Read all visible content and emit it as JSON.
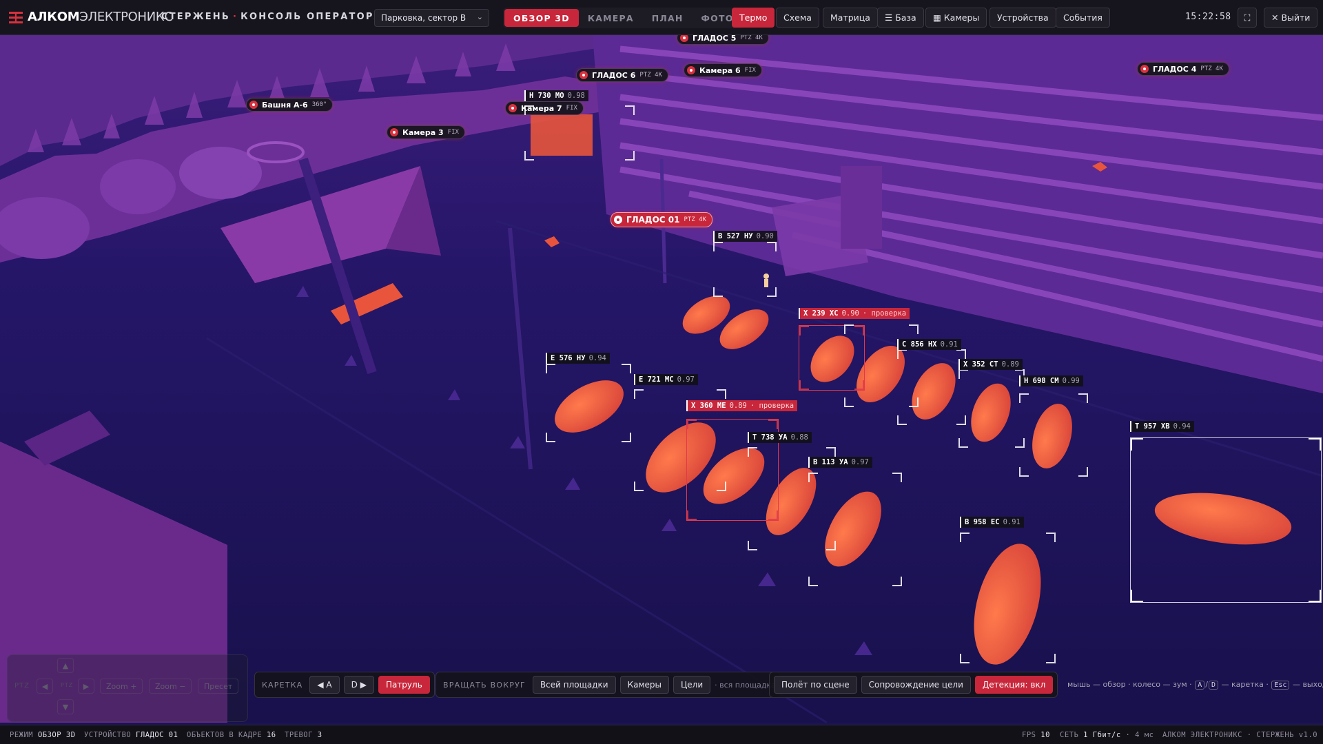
{
  "header": {
    "brand_bold": "АЛКОМ",
    "brand_thin": "ЭЛЕКТРОНИКС",
    "app_name": "СТЕРЖЕНЬ",
    "app_sep": "·",
    "app_section": "КОНСОЛЬ ОПЕРАТОРА",
    "sector": "Парковка, сектор В",
    "view_tabs": [
      {
        "label": "ОБЗОР 3D",
        "active": true
      },
      {
        "label": "КАМЕРА",
        "active": false
      },
      {
        "label": "ПЛАН",
        "active": false
      },
      {
        "label": "ФОТО",
        "active": false
      }
    ],
    "thermo": "Термо",
    "scheme": "Схема",
    "matrix": "Матрица",
    "base": "☰ База",
    "cameras": "▦ Камеры",
    "devices": "Устройства",
    "events": "События",
    "clock": "15:22:58",
    "fullscreen_icon": "⛶",
    "logout": "✕ Выйти"
  },
  "cameras": [
    {
      "name": "ГЛАДОС 5",
      "type": "PTZ 4K"
    },
    {
      "name": "Камера 6",
      "type": "FIX"
    },
    {
      "name": "ГЛАДОС 6",
      "type": "PTZ 4K"
    },
    {
      "name": "ГЛАДОС 4",
      "type": "PTZ 4K"
    },
    {
      "name": "Башня А-6",
      "type": "360°"
    },
    {
      "name": "Камера 7",
      "type": "FIX"
    },
    {
      "name": "Камера 3",
      "type": "FIX"
    },
    {
      "name": "ГЛАДОС 01",
      "type": "PTZ 4K"
    }
  ],
  "plates": [
    {
      "text": "Н 730 МО",
      "conf": "0.98",
      "note": ""
    },
    {
      "text": "В 527 НУ",
      "conf": "0.90",
      "note": ""
    },
    {
      "text": "Х 239 ХС",
      "conf": "0.90",
      "note": "· проверка"
    },
    {
      "text": "С 856 НХ",
      "conf": "0.91",
      "note": ""
    },
    {
      "text": "Х 352 СТ",
      "conf": "0.89",
      "note": ""
    },
    {
      "text": "Е 576 НУ",
      "conf": "0.94",
      "note": ""
    },
    {
      "text": "Н 698 СМ",
      "conf": "0.99",
      "note": ""
    },
    {
      "text": "Е 721 МС",
      "conf": "0.97",
      "note": ""
    },
    {
      "text": "Х 360 МЕ",
      "conf": "0.89",
      "note": "· проверка"
    },
    {
      "text": "Т 738 УА",
      "conf": "0.88",
      "note": ""
    },
    {
      "text": "В 113 УА",
      "conf": "0.97",
      "note": ""
    },
    {
      "text": "Т 957 ХВ",
      "conf": "0.94",
      "note": ""
    },
    {
      "text": "В 958 ЕС",
      "conf": "0.91",
      "note": ""
    }
  ],
  "ptz": {
    "label": "PTZ",
    "up": "▲",
    "down": "▼",
    "left": "◀",
    "right": "▶",
    "zoom_in": "Zoom +",
    "zoom_out": "Zoom −",
    "preset": "Пресет"
  },
  "controls": {
    "carriage_label": "КАРЕТКА",
    "carriage_left": "◀ A",
    "carriage_right": "D ▶",
    "patrol": "Патруль",
    "orbit_label": "ВРАЩАТЬ ВОКРУГ",
    "orbit_site": "Всей площадки",
    "orbit_cameras": "Камеры",
    "orbit_targets": "Цели",
    "orbit_note": "· вся площадка",
    "fly": "Полёт по сцене",
    "follow": "Сопровождение цели",
    "detection": "Детекция: вкл"
  },
  "hint": {
    "mouse": "мышь — обзор · колесо — зум ·",
    "key_a": "A",
    "slash": "/",
    "key_d": "D",
    "carriage": "— каретка ·",
    "key_esc": "Esc",
    "exit": "— выход"
  },
  "status": {
    "mode_label": "РЕЖИМ",
    "mode_value": "ОБЗОР 3D",
    "device_label": "УСТРОЙСТВО",
    "device_value": "ГЛАДОС 01",
    "objects_label": "ОБЪЕКТОВ В КАДРЕ",
    "objects_value": "16",
    "alarms_label": "ТРЕВОГ",
    "alarms_value": "3",
    "fps_label": "FPS",
    "fps_value": "10",
    "net_label": "СЕТЬ",
    "net_value": "1 Гбит/с",
    "net_latency": "· 4 мс",
    "footer": "АЛКОМ ЭЛЕКТРОНИКС · СТЕРЖЕНЬ v1.0"
  },
  "colors": {
    "accent": "#c8263a",
    "scene_bg": "#1a1454",
    "heat": "#e8553c"
  }
}
